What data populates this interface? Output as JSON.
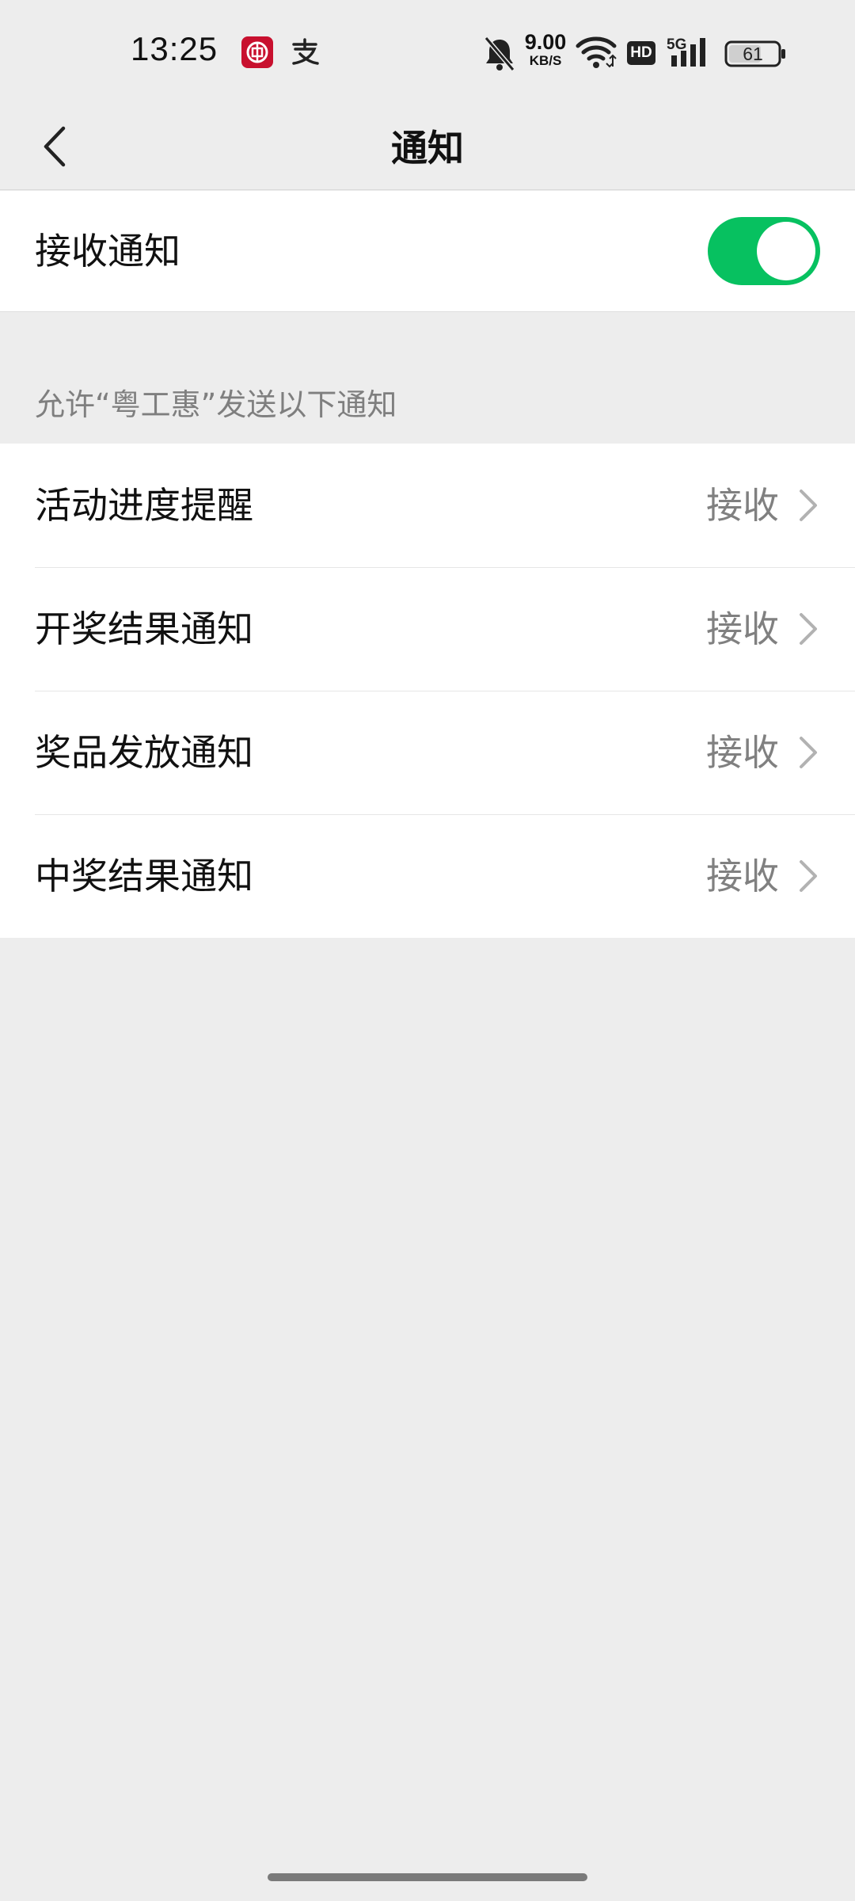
{
  "status_bar": {
    "time": "13:25",
    "app_icons": [
      "bank-app-icon",
      "alipay-icon"
    ],
    "mute_icon": "bell-off-icon",
    "net_speed_value": "9.00",
    "net_speed_unit": "KB/S",
    "wifi_icon": "wifi-icon",
    "hd_label": "HD",
    "network_label": "5G",
    "battery_level": "61"
  },
  "nav": {
    "back_icon": "chevron-left-icon",
    "title": "通知"
  },
  "master": {
    "label": "接收通知",
    "enabled": true,
    "accent_color": "#07c160"
  },
  "section": {
    "header": "允许“粤工惠”发送以下通知"
  },
  "items": [
    {
      "label": "活动进度提醒",
      "value": "接收"
    },
    {
      "label": "开奖结果通知",
      "value": "接收"
    },
    {
      "label": "奖品发放通知",
      "value": "接收"
    },
    {
      "label": "中奖结果通知",
      "value": "接收"
    }
  ]
}
